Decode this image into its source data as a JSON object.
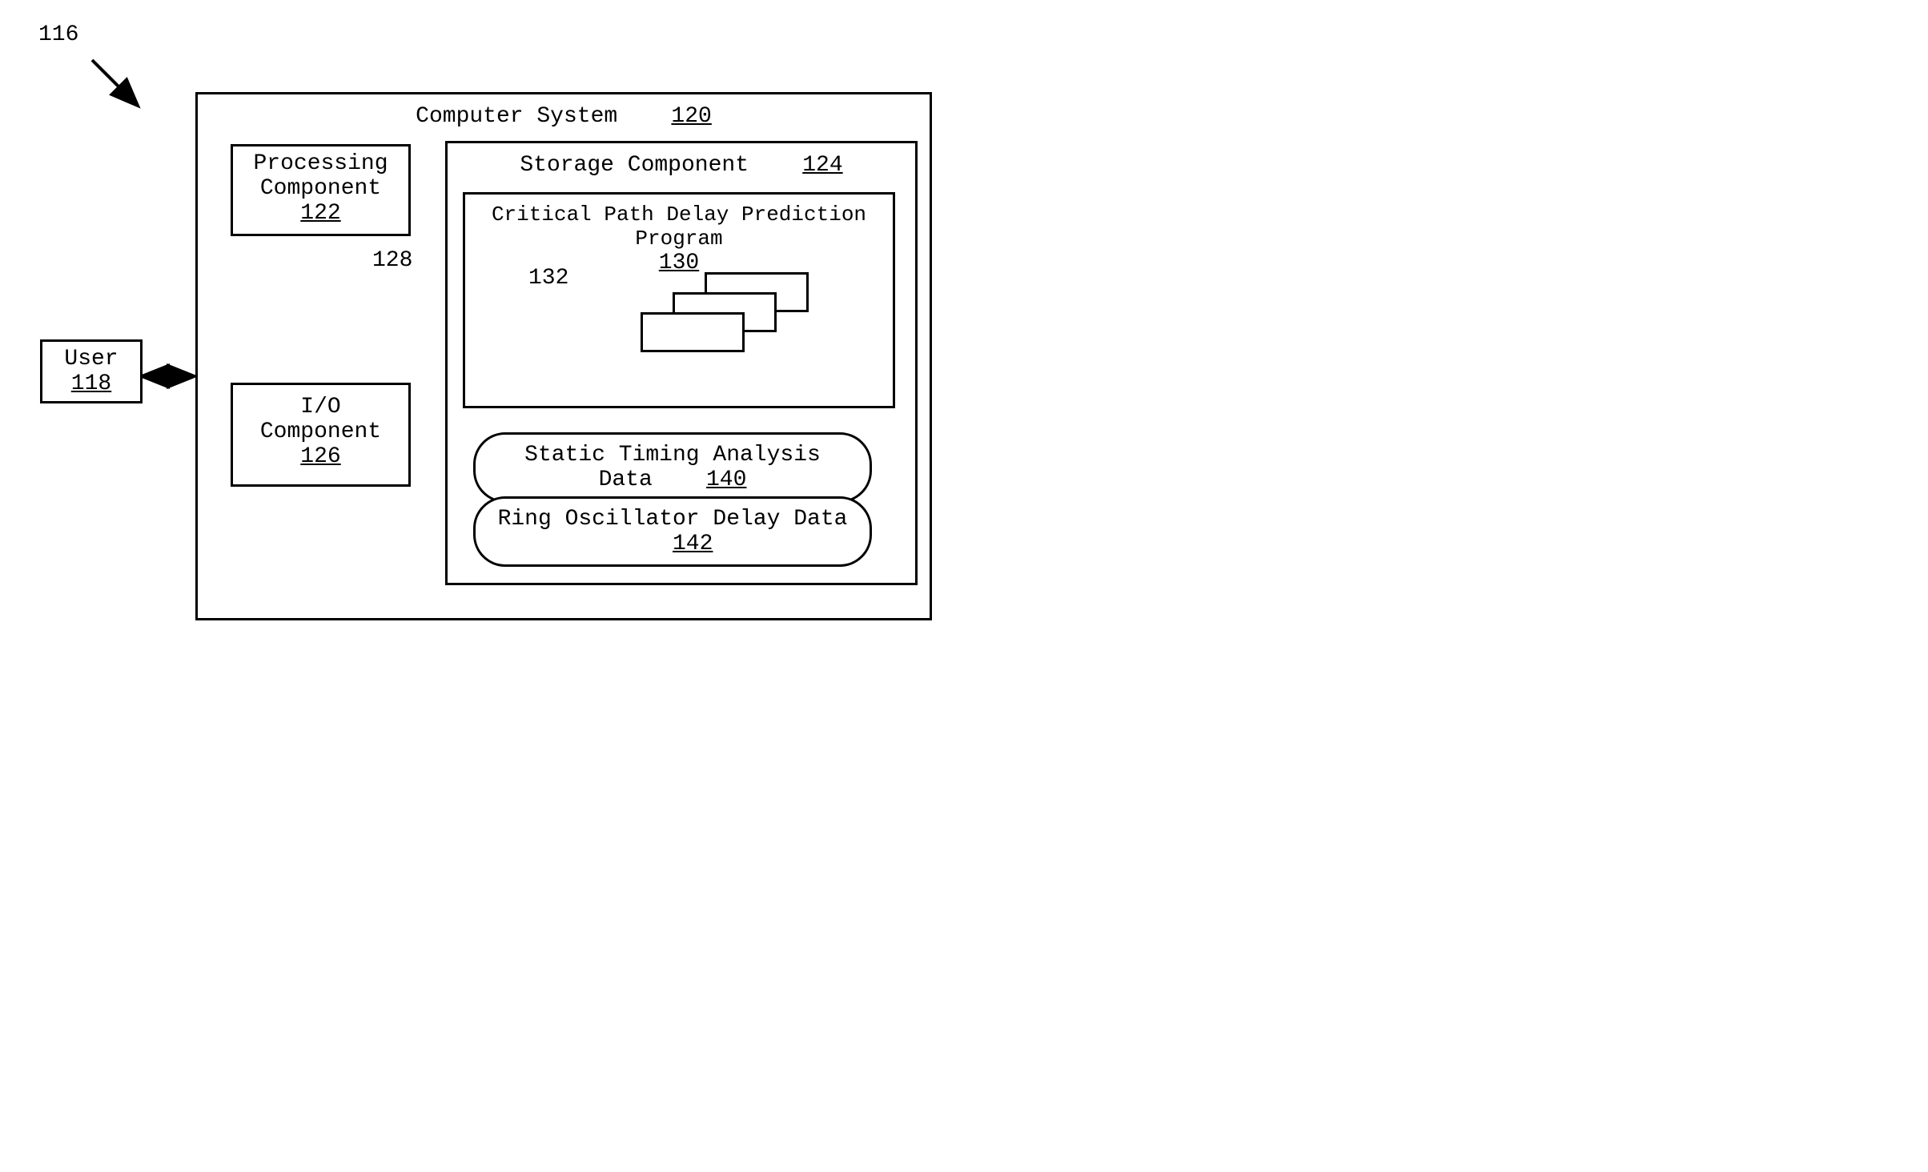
{
  "ref_116": "116",
  "ref_118": "118",
  "ref_120": "120",
  "ref_122": "122",
  "ref_124": "124",
  "ref_126": "126",
  "ref_128": "128",
  "ref_130": "130",
  "ref_132": "132",
  "ref_140": "140",
  "ref_142": "142",
  "user_label": "User",
  "computer_system_label": "Computer System",
  "processing_component_label1": "Processing",
  "processing_component_label2": "Component",
  "io_component_label1": "I/O",
  "io_component_label2": "Component",
  "storage_component_label": "Storage Component",
  "program_label": "Critical Path Delay Prediction Program",
  "static_timing_label": "Static Timing Analysis Data",
  "ring_osc_label": "Ring Oscillator Delay Data"
}
